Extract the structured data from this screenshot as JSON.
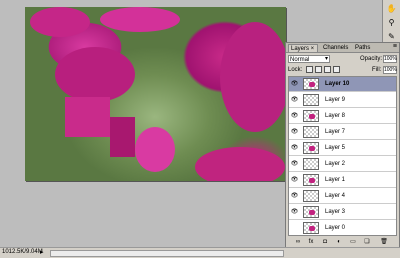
{
  "status": {
    "text": "1012.5K/9.04M",
    "arrow_icon": "right-arrow-icon"
  },
  "layers_panel": {
    "tabs": [
      {
        "label": "Layers ×",
        "active": true
      },
      {
        "label": "Channels",
        "active": false
      },
      {
        "label": "Paths",
        "active": false
      }
    ],
    "blend_mode": "Normal",
    "opacity_label": "Opacity:",
    "opacity_value": "100%",
    "lock_label": "Lock:",
    "fill_label": "Fill:",
    "fill_value": "100%",
    "layers": [
      {
        "name": "Layer 10",
        "selected": true,
        "visible": true,
        "thumb": "spot"
      },
      {
        "name": "Layer 9",
        "selected": false,
        "visible": true,
        "thumb": "empty"
      },
      {
        "name": "Layer 8",
        "selected": false,
        "visible": true,
        "thumb": "spot"
      },
      {
        "name": "Layer 7",
        "selected": false,
        "visible": true,
        "thumb": "empty"
      },
      {
        "name": "Layer 5",
        "selected": false,
        "visible": true,
        "thumb": "spot"
      },
      {
        "name": "Layer 2",
        "selected": false,
        "visible": true,
        "thumb": "empty"
      },
      {
        "name": "Layer 1",
        "selected": false,
        "visible": true,
        "thumb": "spot"
      },
      {
        "name": "Layer 4",
        "selected": false,
        "visible": true,
        "thumb": "empty"
      },
      {
        "name": "Layer 3",
        "selected": false,
        "visible": true,
        "thumb": "spot"
      },
      {
        "name": "Layer 0",
        "selected": false,
        "visible": false,
        "thumb": "spot"
      }
    ]
  },
  "colors": {
    "magenta": "#c2227f",
    "selection": "#8f96b6",
    "foliage": "#7f9a63"
  }
}
